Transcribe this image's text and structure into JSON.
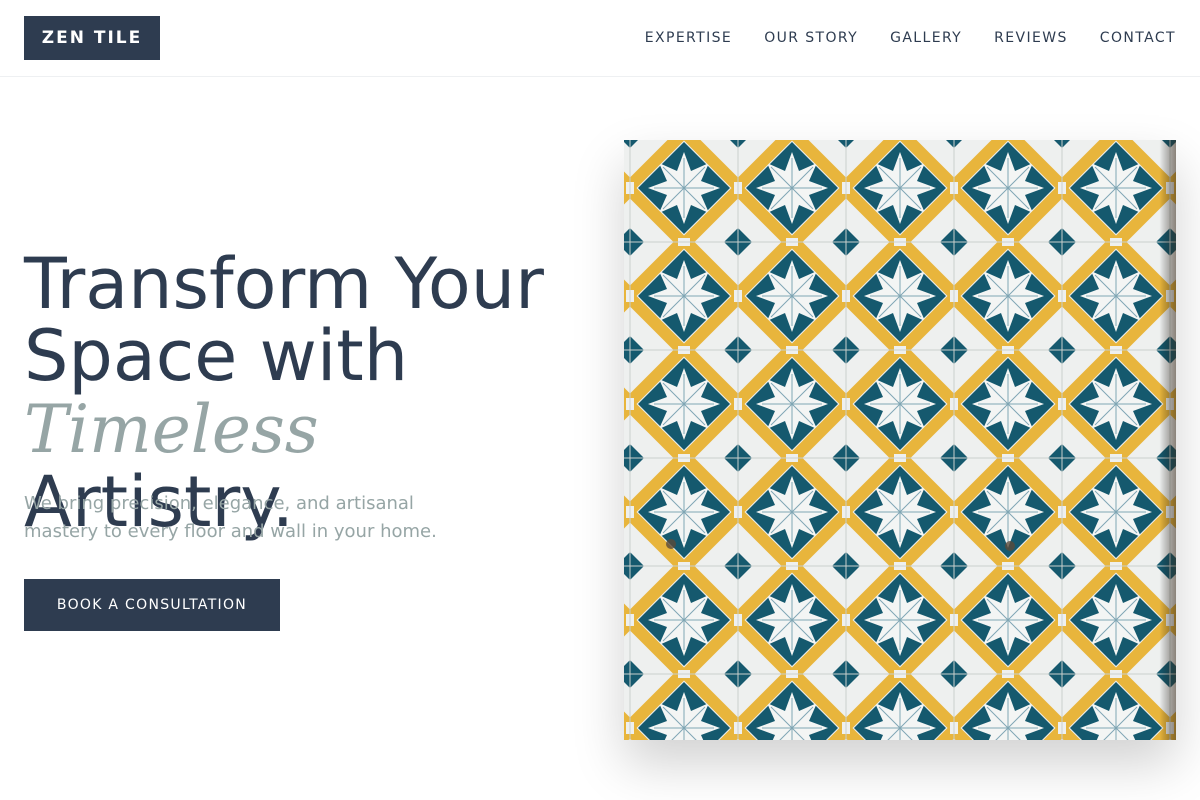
{
  "brand": {
    "name": "ZEN TILE"
  },
  "nav": {
    "items": [
      {
        "label": "EXPERTISE"
      },
      {
        "label": "OUR STORY"
      },
      {
        "label": "GALLERY"
      },
      {
        "label": "REVIEWS"
      },
      {
        "label": "CONTACT"
      }
    ]
  },
  "hero": {
    "headline_line1": "Transform Your",
    "headline_line2": "Space with",
    "headline_accent": "Timeless",
    "headline_line3_rest": " Artistry.",
    "subtext": "We bring precision, elegance, and artisanal mastery to every floor and wall in your home.",
    "cta_label": "BOOK A CONSULTATION",
    "image_icon": "azulejo-tile-pattern-image"
  },
  "colors": {
    "primary": "#2e3c50",
    "muted": "#96a5a5",
    "tile_yellow": "#e8b53c",
    "tile_teal": "#15596e",
    "tile_white": "#eef0ef"
  }
}
